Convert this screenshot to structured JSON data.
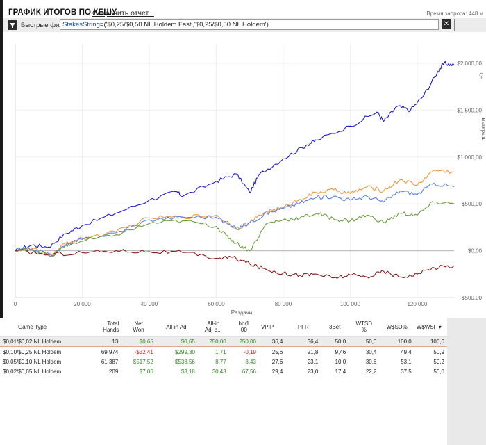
{
  "header": {
    "title": "ГРАФИК ИТОГОВ ПО КЕШУ",
    "save_link": "Сохранить отчет...",
    "query_time": "Время запроса: 448 м"
  },
  "filter": {
    "label": "Быстрые фильт",
    "key": "StakesString",
    "op": "=",
    "value": "('$0,25/$0,50 NL Holdem Fast','$0,25/$0,50 NL Holdem')",
    "clear_icon": "close-icon"
  },
  "chart_data": {
    "type": "line",
    "xlabel": "Раздачи",
    "ylabel": "Выигрыш",
    "xlim": [
      0,
      131000
    ],
    "ylim": [
      -500,
      2200
    ],
    "x_ticks": [
      0,
      20000,
      40000,
      60000,
      80000,
      100000,
      120000
    ],
    "x_tick_labels": [
      "0",
      "20 000",
      "40 000",
      "60 000",
      "80 000",
      "100 000",
      "120 000"
    ],
    "y_ticks": [
      2000,
      1500,
      1000,
      500,
      0,
      -500
    ],
    "y_tick_labels": [
      "$2 000,00",
      "$1 500,00",
      "$1 000,00",
      "$500,00",
      "$0,00",
      "-$500,00"
    ],
    "series": [
      {
        "color": "#1a1ad6",
        "values": [
          [
            0,
            0
          ],
          [
            5000,
            60
          ],
          [
            10000,
            40
          ],
          [
            15000,
            180
          ],
          [
            20000,
            270
          ],
          [
            30000,
            400
          ],
          [
            40000,
            540
          ],
          [
            48000,
            630
          ],
          [
            50000,
            580
          ],
          [
            60000,
            740
          ],
          [
            66000,
            820
          ],
          [
            70000,
            620
          ],
          [
            73000,
            820
          ],
          [
            80000,
            980
          ],
          [
            87000,
            1130
          ],
          [
            90000,
            1180
          ],
          [
            100000,
            1330
          ],
          [
            108000,
            1480
          ],
          [
            110000,
            1380
          ],
          [
            114000,
            1540
          ],
          [
            118000,
            1500
          ],
          [
            122000,
            1660
          ],
          [
            126000,
            1900
          ],
          [
            128000,
            2000
          ],
          [
            131000,
            1980
          ]
        ]
      },
      {
        "color": "#f2953a",
        "values": [
          [
            0,
            0
          ],
          [
            5000,
            20
          ],
          [
            11000,
            -50
          ],
          [
            15000,
            80
          ],
          [
            20000,
            130
          ],
          [
            30000,
            200
          ],
          [
            40000,
            350
          ],
          [
            50000,
            360
          ],
          [
            60000,
            380
          ],
          [
            66000,
            240
          ],
          [
            70000,
            300
          ],
          [
            75000,
            420
          ],
          [
            80000,
            460
          ],
          [
            85000,
            550
          ],
          [
            90000,
            620
          ],
          [
            95000,
            650
          ],
          [
            100000,
            610
          ],
          [
            105000,
            680
          ],
          [
            110000,
            640
          ],
          [
            115000,
            760
          ],
          [
            120000,
            700
          ],
          [
            125000,
            860
          ],
          [
            131000,
            840
          ]
        ]
      },
      {
        "color": "#5a7fe6",
        "values": [
          [
            0,
            0
          ],
          [
            5000,
            20
          ],
          [
            11000,
            -50
          ],
          [
            15000,
            60
          ],
          [
            20000,
            120
          ],
          [
            30000,
            190
          ],
          [
            40000,
            330
          ],
          [
            50000,
            360
          ],
          [
            60000,
            360
          ],
          [
            66000,
            230
          ],
          [
            70000,
            300
          ],
          [
            75000,
            400
          ],
          [
            80000,
            450
          ],
          [
            85000,
            510
          ],
          [
            90000,
            570
          ],
          [
            95000,
            580
          ],
          [
            100000,
            540
          ],
          [
            105000,
            580
          ],
          [
            110000,
            520
          ],
          [
            115000,
            640
          ],
          [
            120000,
            600
          ],
          [
            125000,
            720
          ],
          [
            131000,
            680
          ]
        ]
      },
      {
        "color": "#6a9e3c",
        "values": [
          [
            0,
            0
          ],
          [
            5000,
            20
          ],
          [
            11000,
            -60
          ],
          [
            15000,
            60
          ],
          [
            20000,
            100
          ],
          [
            30000,
            170
          ],
          [
            40000,
            290
          ],
          [
            50000,
            320
          ],
          [
            60000,
            260
          ],
          [
            63000,
            160
          ],
          [
            66000,
            80
          ],
          [
            70000,
            0
          ],
          [
            75000,
            290
          ],
          [
            80000,
            330
          ],
          [
            85000,
            350
          ],
          [
            90000,
            400
          ],
          [
            95000,
            340
          ],
          [
            100000,
            320
          ],
          [
            105000,
            380
          ],
          [
            110000,
            300
          ],
          [
            115000,
            400
          ],
          [
            120000,
            380
          ],
          [
            125000,
            520
          ],
          [
            131000,
            500
          ]
        ]
      },
      {
        "color": "#8b1a1a",
        "values": [
          [
            0,
            0
          ],
          [
            10000,
            -40
          ],
          [
            20000,
            -20
          ],
          [
            30000,
            0
          ],
          [
            40000,
            -10
          ],
          [
            50000,
            -20
          ],
          [
            60000,
            -80
          ],
          [
            65000,
            -70
          ],
          [
            70000,
            -140
          ],
          [
            75000,
            -200
          ],
          [
            80000,
            -240
          ],
          [
            85000,
            -260
          ],
          [
            90000,
            -250
          ],
          [
            95000,
            -290
          ],
          [
            100000,
            -260
          ],
          [
            105000,
            -280
          ],
          [
            110000,
            -220
          ],
          [
            115000,
            -280
          ],
          [
            120000,
            -250
          ],
          [
            125000,
            -180
          ],
          [
            131000,
            -160
          ]
        ]
      }
    ]
  },
  "grid": {
    "columns": [
      "Game Type",
      "Total Hands",
      "Net Won",
      "All-in Adj",
      "All-in Adj b...",
      "bb/100",
      "VPIP",
      "PFR",
      "3Bet",
      "WTSD %",
      "W$SD%",
      "W$WSF"
    ],
    "column_lines": [
      [
        "Game Type"
      ],
      [
        "Total",
        "Hands"
      ],
      [
        "Net",
        "Won"
      ],
      [
        "All-in Adj"
      ],
      [
        "All-in",
        "Adj b..."
      ],
      [
        "bb/1",
        "00"
      ],
      [
        "VPIP"
      ],
      [
        "PFR"
      ],
      [
        "3Bet"
      ],
      [
        "WTSD",
        "%"
      ],
      [
        "W$SD%"
      ],
      [
        "W$WSF"
      ]
    ],
    "sort_icon": "sort-down-icon",
    "rows": [
      {
        "game_type": "$0,01/$0,02 NL Holdem",
        "total_hands": "13",
        "net_won": "$0,65",
        "all_in_adj": "$0,65",
        "all_in_adj_bb": "250,00",
        "bb100": "250,00",
        "vpip": "36,4",
        "pfr": "36,4",
        "threebet": "50,0",
        "wtsd": "50,0",
        "wsd": "100,0",
        "wwsf": "100,0"
      },
      {
        "game_type": "$0,10/$0,25 NL Holdem",
        "total_hands": "69 974",
        "net_won": "-$32,41",
        "all_in_adj": "$299,30",
        "all_in_adj_bb": "1,71",
        "bb100": "-0,19",
        "vpip": "25,6",
        "pfr": "21,8",
        "threebet": "9,46",
        "wtsd": "30,4",
        "wsd": "49,4",
        "wwsf": "50,9"
      },
      {
        "game_type": "$0,05/$0,10 NL Holdem",
        "total_hands": "61 387",
        "net_won": "$517,52",
        "all_in_adj": "$538,56",
        "all_in_adj_bb": "8,77",
        "bb100": "8,43",
        "vpip": "27,6",
        "pfr": "23,1",
        "threebet": "10,0",
        "wtsd": "30,6",
        "wsd": "53,1",
        "wwsf": "50,2"
      },
      {
        "game_type": "$0,02/$0,05 NL Holdem",
        "total_hands": "209",
        "net_won": "$7,06",
        "all_in_adj": "$3,18",
        "all_in_adj_bb": "30,43",
        "bb100": "67,56",
        "vpip": "29,4",
        "pfr": "23,0",
        "threebet": "17,4",
        "wtsd": "22,2",
        "wsd": "37,5",
        "wwsf": "50,0"
      }
    ]
  }
}
